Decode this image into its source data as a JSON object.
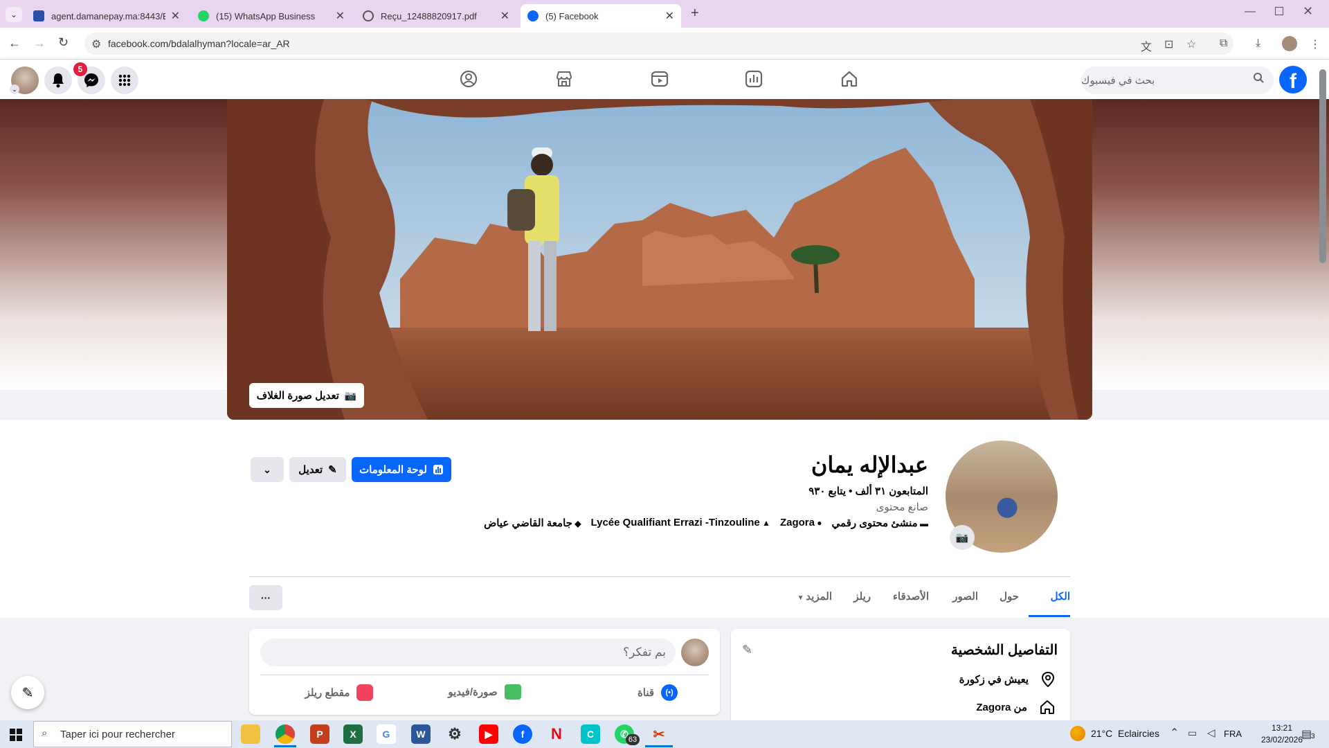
{
  "browser": {
    "tabs": [
      {
        "label": "agent.damanepay.ma:8443/EDP",
        "close": "✕"
      },
      {
        "label": "(15) WhatsApp Business",
        "close": "✕"
      },
      {
        "label": "Reçu_12488820917.pdf",
        "close": "✕"
      },
      {
        "label": "(5) Facebook",
        "close": "✕"
      }
    ],
    "new_tab": "+",
    "url": "facebook.com/bdalalhyman?locale=ar_AR"
  },
  "topbar": {
    "search_placeholder": "بحث في فيسبوك",
    "notification_count": "5"
  },
  "cover": {
    "edit_label": "تعديل صورة الغلاف"
  },
  "profile": {
    "name": "عبدالإله يمان",
    "followers_line": "المتابعون ٣١ ألف • يتابع ٩٣٠",
    "category": "صانع محتوى",
    "details": [
      {
        "icon": "briefcase-icon",
        "text": "منشئ محتوى رقمي"
      },
      {
        "icon": "location-pin-icon",
        "text": "Zagora"
      },
      {
        "icon": "school-icon",
        "text": "Lycée Qualifiant Errazi -Tinzouline"
      },
      {
        "icon": "graduation-cap-icon",
        "text": "جامعة القاضي عياض"
      }
    ],
    "dashboard_label": "لوحة المعلومات",
    "edit_label": "تعديل"
  },
  "profile_tabs": {
    "items": [
      "الكل",
      "حول",
      "الصور",
      "الأصدقاء",
      "ريلز"
    ],
    "more": "المزيد",
    "dots": "···"
  },
  "details_card": {
    "title": "التفاصيل الشخصية",
    "rows": [
      {
        "icon": "location-pin-icon",
        "text": "يعيش في زكورة"
      },
      {
        "icon": "home-icon",
        "text": "من Zagora"
      }
    ]
  },
  "composer": {
    "placeholder": "بم تفكر؟",
    "actions": [
      {
        "label": "قناة",
        "icon": "live-channel-icon"
      },
      {
        "label": "صورة/فيديو",
        "icon": "photo-video-icon"
      },
      {
        "label": "مقطع ريلز",
        "icon": "reels-icon"
      }
    ]
  },
  "taskbar": {
    "search_placeholder": "Taper ici pour rechercher",
    "weather": "21°C  Eclaircies",
    "language": "FRA",
    "time": "13:21",
    "date": "23/02/2026",
    "whatsapp_badge": "63",
    "notif_count": "3"
  },
  "colors": {
    "fb_blue": "#0866ff",
    "tab_strip": "#e9d5f0",
    "notif_red": "#e41e3f"
  }
}
